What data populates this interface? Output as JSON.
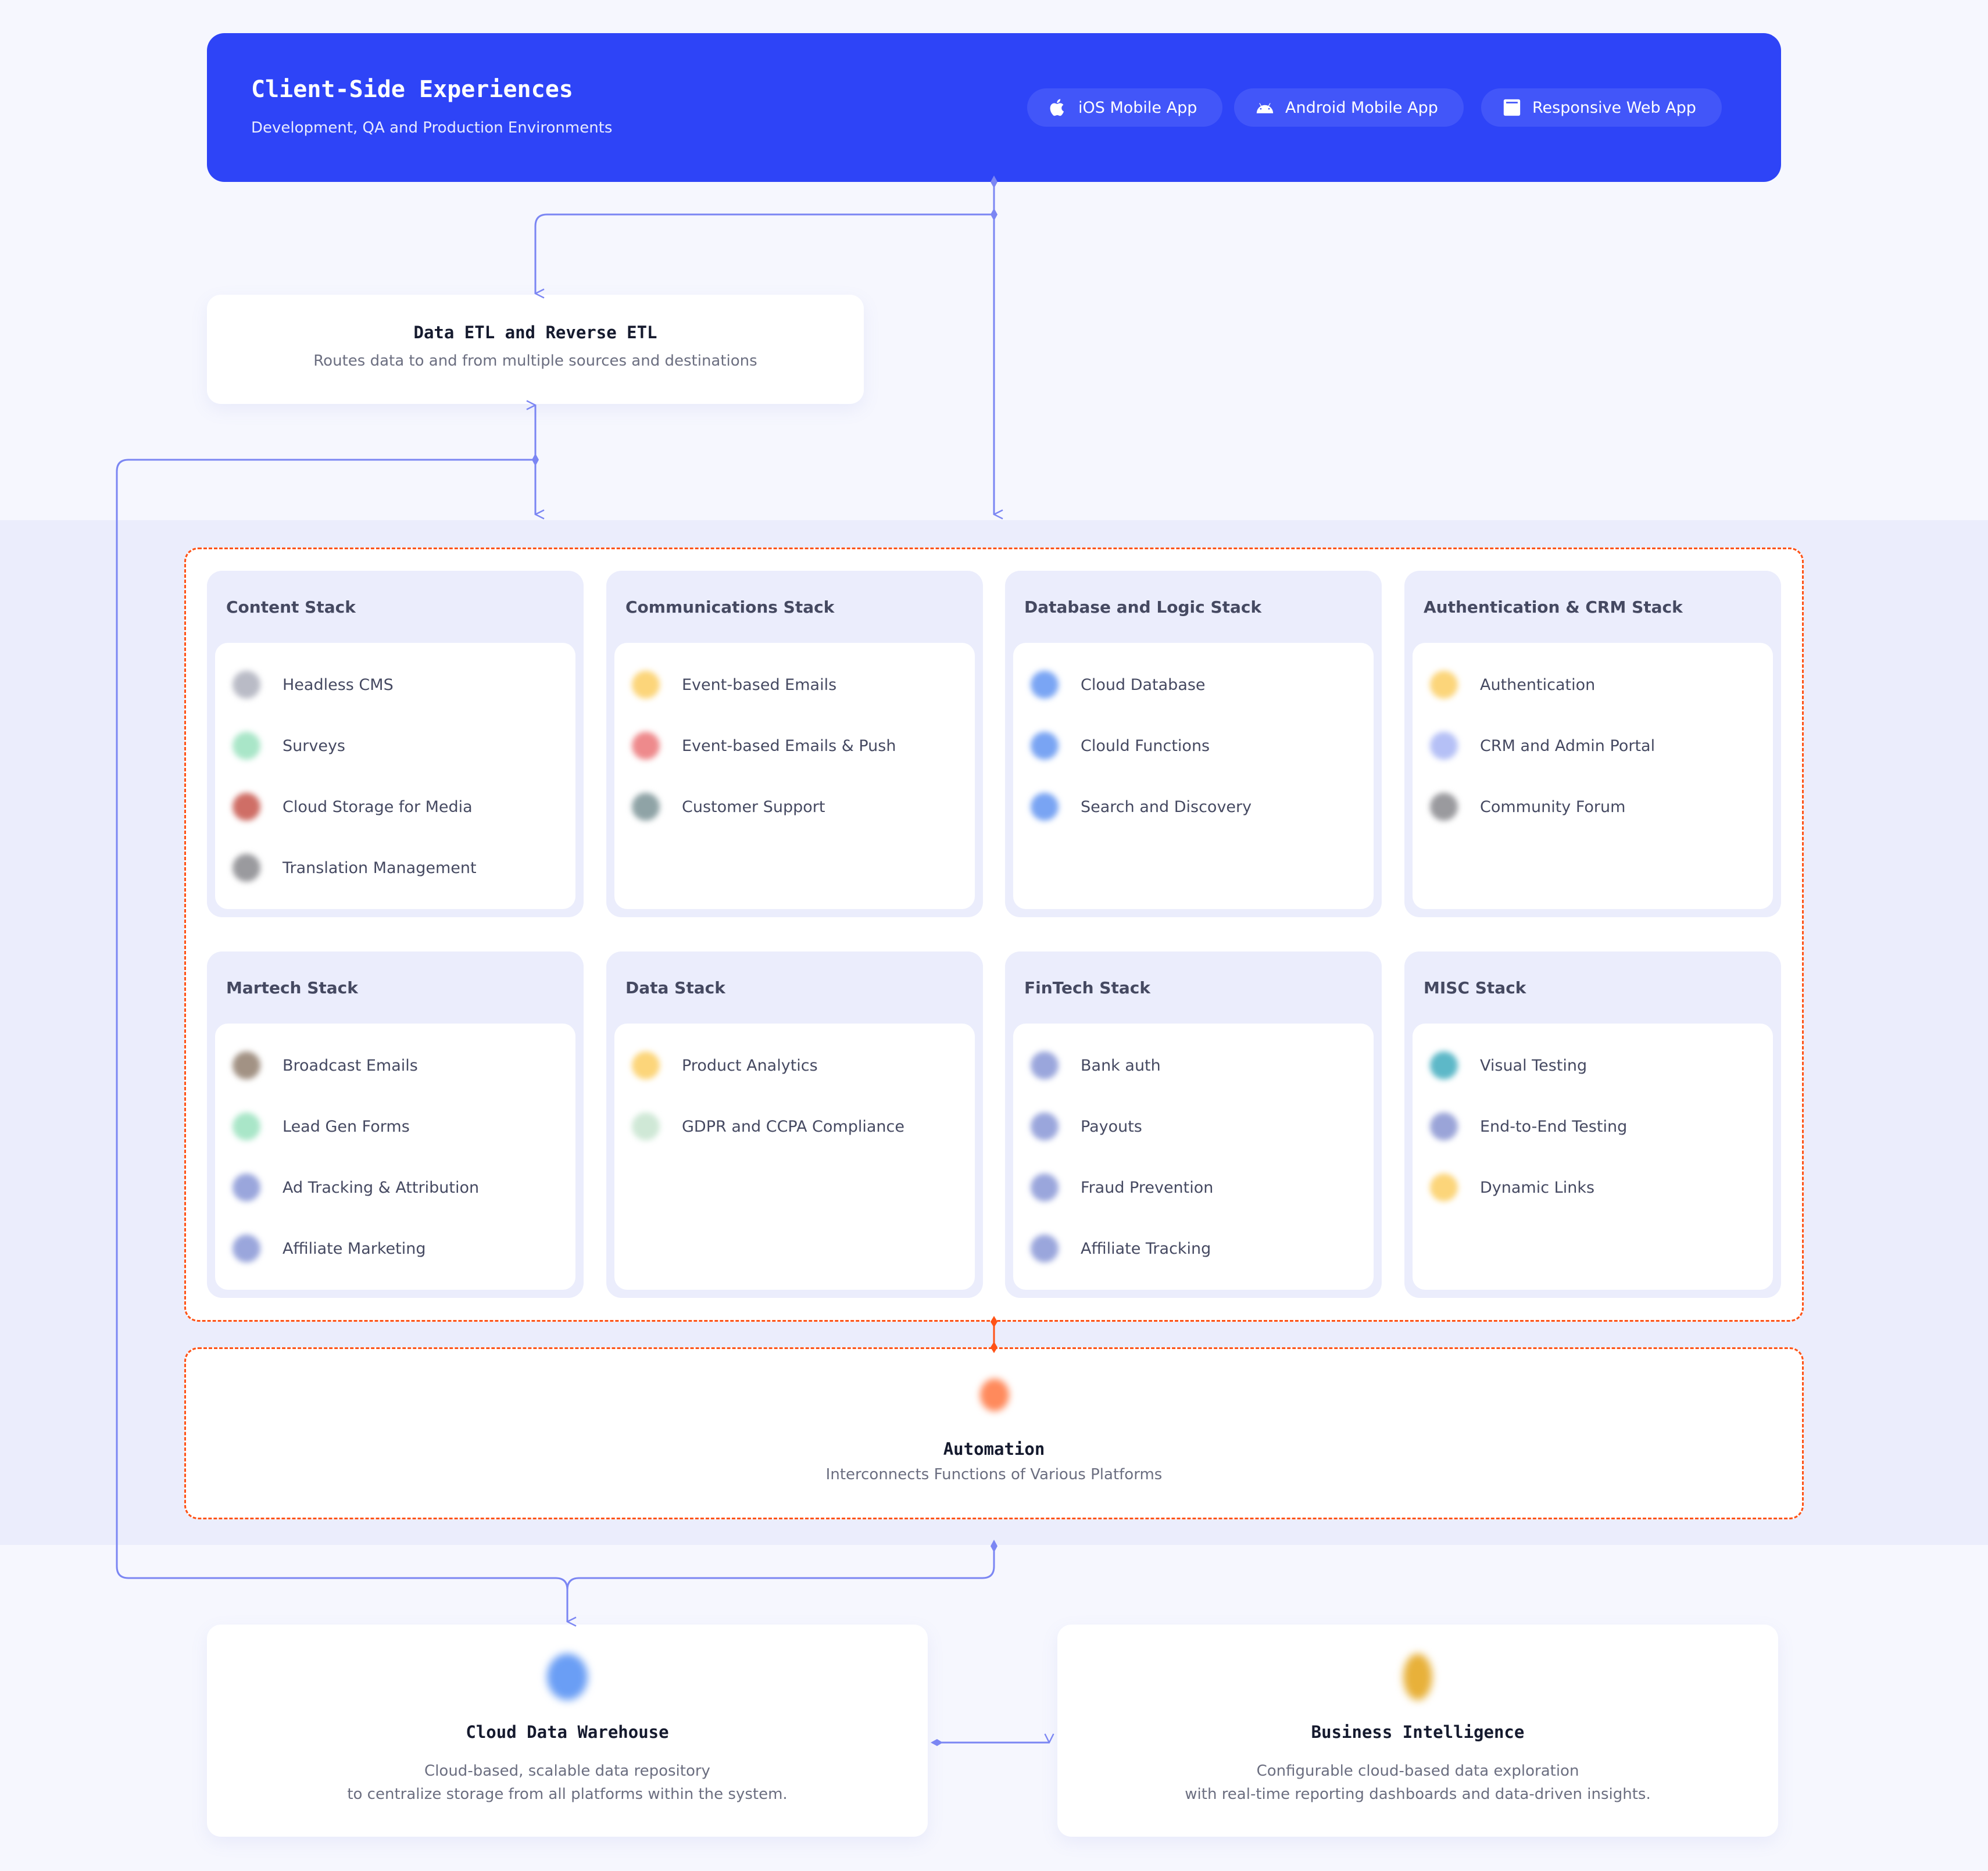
{
  "header": {
    "title": "Client-Side Experiences",
    "subtitle": "Development, QA and Production Environments",
    "platforms": [
      {
        "label": "iOS Mobile App",
        "icon": "apple-icon"
      },
      {
        "label": "Android Mobile App",
        "icon": "android-icon"
      },
      {
        "label": "Responsive Web App",
        "icon": "browser-window-icon"
      }
    ]
  },
  "etl": {
    "title": "Data ETL and Reverse ETL",
    "description": "Routes data to and from multiple sources and destinations"
  },
  "stacks": [
    {
      "title": "Content Stack",
      "items": [
        {
          "label": "Headless CMS",
          "color": "#b9bbc6"
        },
        {
          "label": "Surveys",
          "color": "#a9e6c8"
        },
        {
          "label": "Cloud Storage for Media",
          "color": "#cf6e66"
        },
        {
          "label": "Translation Management",
          "color": "#9a9a9e"
        }
      ]
    },
    {
      "title": "Communications Stack",
      "items": [
        {
          "label": "Event-based Emails",
          "color": "#fcd57a"
        },
        {
          "label": "Event-based Emails & Push",
          "color": "#ee8a8c"
        },
        {
          "label": "Customer Support",
          "color": "#8fa3a6"
        }
      ]
    },
    {
      "title": "Database and Logic Stack",
      "items": [
        {
          "label": "Cloud Database",
          "color": "#7aa5f4"
        },
        {
          "label": "Clould Functions",
          "color": "#79a4f3"
        },
        {
          "label": "Search and Discovery",
          "color": "#79a4f3"
        }
      ]
    },
    {
      "title": "Authentication & CRM Stack",
      "items": [
        {
          "label": "Authentication",
          "color": "#fcd57a"
        },
        {
          "label": "CRM and Admin Portal",
          "color": "#b5c0f6"
        },
        {
          "label": "Community Forum",
          "color": "#9a9a9e"
        }
      ]
    },
    {
      "title": "Martech Stack",
      "items": [
        {
          "label": "Broadcast Emails",
          "color": "#a29284"
        },
        {
          "label": "Lead Gen Forms",
          "color": "#a9e6c8"
        },
        {
          "label": "Ad Tracking & Attribution",
          "color": "#9aa6dc"
        },
        {
          "label": "Affiliate Marketing",
          "color": "#9aa6dc"
        }
      ]
    },
    {
      "title": "Data Stack",
      "items": [
        {
          "label": "Product Analytics",
          "color": "#fcd57a"
        },
        {
          "label": "GDPR and CCPA Compliance",
          "color": "#cfe8d6"
        }
      ]
    },
    {
      "title": "FinTech Stack",
      "items": [
        {
          "label": "Bank auth",
          "color": "#9aa6dc"
        },
        {
          "label": "Payouts",
          "color": "#9aa6dc"
        },
        {
          "label": "Fraud Prevention",
          "color": "#9aa6dc"
        },
        {
          "label": "Affiliate Tracking",
          "color": "#9aa6dc"
        }
      ]
    },
    {
      "title": "MISC Stack",
      "items": [
        {
          "label": "Visual Testing",
          "color": "#5db8c8"
        },
        {
          "label": "End-to-End Testing",
          "color": "#9aa4d8"
        },
        {
          "label": "Dynamic Links",
          "color": "#fcd57a"
        }
      ]
    }
  ],
  "automation": {
    "title": "Automation",
    "description": "Interconnects Functions of Various Platforms"
  },
  "warehouse": {
    "title": "Cloud Data Warehouse",
    "description_line1": "Cloud-based, scalable data repository",
    "description_line2": "to centralize storage from all platforms within the system."
  },
  "bi": {
    "title": "Business Intelligence",
    "description_line1": "Configurable cloud-based data exploration",
    "description_line2": "with real-time reporting dashboards and data-driven insights."
  },
  "colors": {
    "brand": "#2e44f7",
    "connector": "#7b86f3",
    "dashed_border": "#ff5216",
    "band": "#ebedfc",
    "page": "#f6f7fe"
  }
}
